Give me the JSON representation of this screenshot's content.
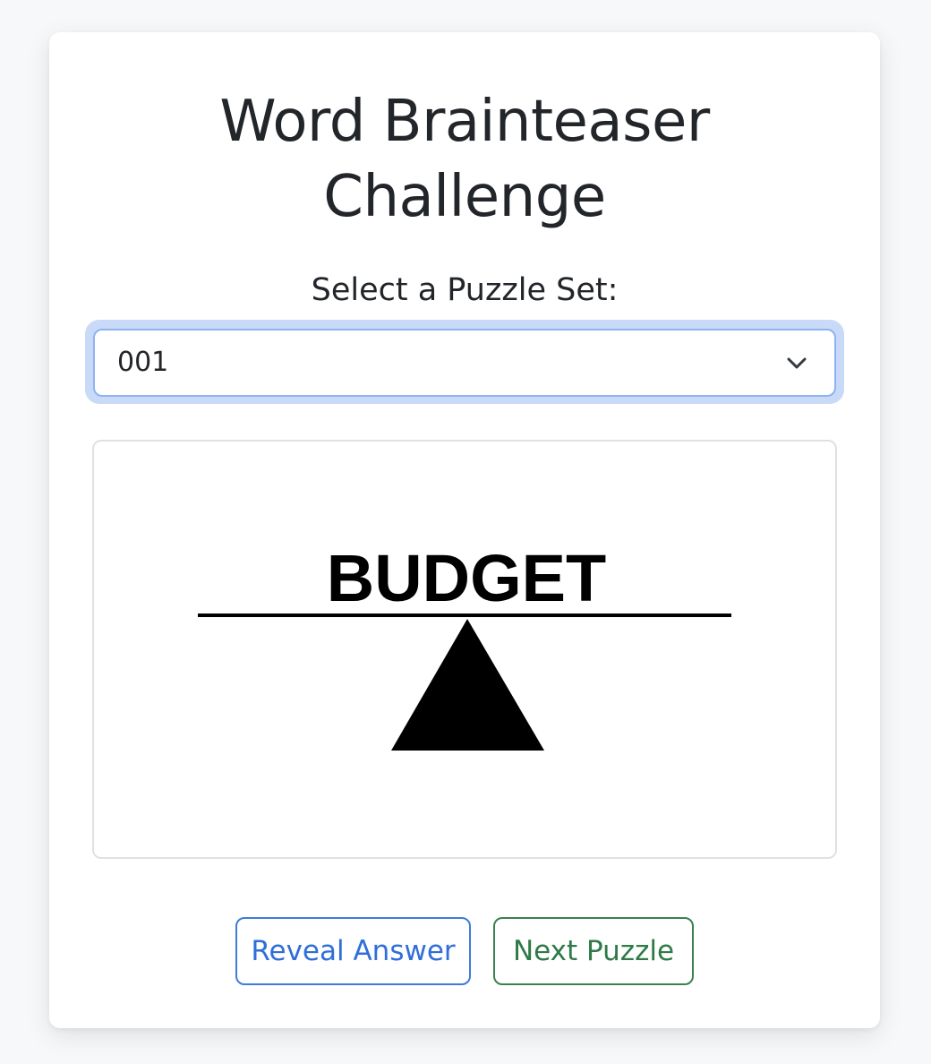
{
  "app": {
    "title_line1": "Word Brainteaser",
    "title_line2": "Challenge"
  },
  "selector": {
    "label": "Select a Puzzle Set:",
    "selected_value": "001",
    "icon": "chevron-down-icon"
  },
  "puzzle": {
    "word": "BUDGET",
    "graphic": "seesaw-balance"
  },
  "actions": {
    "reveal_label": "Reveal Answer",
    "next_label": "Next Puzzle"
  },
  "colors": {
    "reveal_accent": "#2f6fd8",
    "next_accent": "#2f7a47",
    "focus_ring": "#c9daf8"
  }
}
